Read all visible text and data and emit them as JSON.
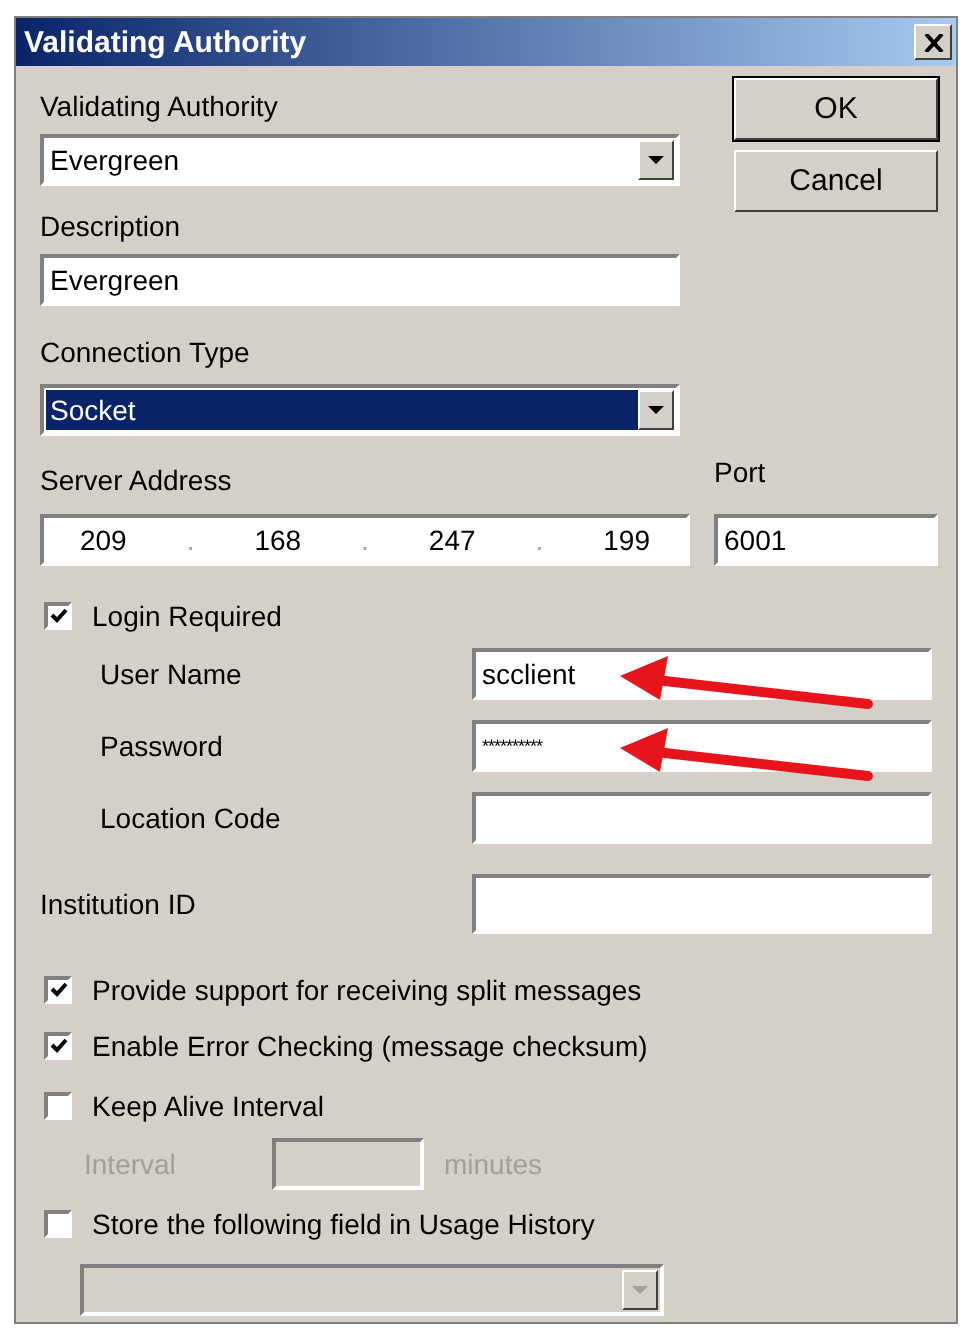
{
  "window": {
    "title": "Validating Authority"
  },
  "validating_authority": {
    "label": "Validating Authority",
    "value": "Evergreen"
  },
  "description": {
    "label": "Description",
    "value": "Evergreen"
  },
  "connection_type": {
    "label": "Connection Type",
    "value": "Socket",
    "focused": true
  },
  "server_address": {
    "label": "Server Address",
    "octets": [
      "209",
      "168",
      "247",
      "199"
    ],
    "separators": [
      ".",
      ".",
      "."
    ]
  },
  "port": {
    "label": "Port",
    "value": "6001"
  },
  "login": {
    "label": "Login Required",
    "checked": true,
    "fields": [
      {
        "label": "User Name",
        "value": "scclient",
        "kind": "text",
        "arrow": true
      },
      {
        "label": "Password",
        "value": "**********",
        "kind": "password",
        "arrow": true
      },
      {
        "label": "Location Code",
        "kind": "text",
        "arrow": false
      }
    ]
  },
  "institution_id": {
    "label": "Institution ID"
  },
  "options": [
    {
      "label": "Provide support for receiving split messages",
      "checked": true
    },
    {
      "label": "Enable Error Checking (message checksum)",
      "checked": true
    },
    {
      "label": "Keep Alive Interval",
      "checked": false
    }
  ],
  "interval": {
    "label": "Interval",
    "unit": "minutes",
    "disabled": true
  },
  "usage_history": {
    "label": "Store the following field in Usage History",
    "checked": false,
    "disabled": true
  },
  "buttons": [
    {
      "label": "OK",
      "default": true
    },
    {
      "label": "Cancel",
      "default": false
    }
  ]
}
